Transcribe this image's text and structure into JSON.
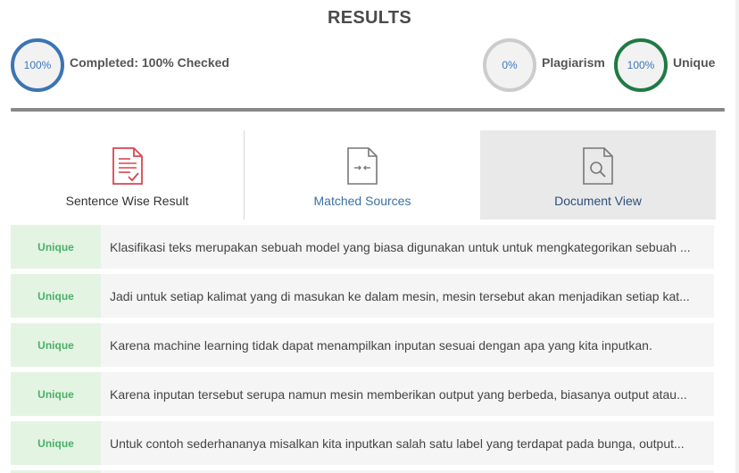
{
  "header": {
    "title": "RESULTS"
  },
  "stats": {
    "completed": {
      "value": "100%",
      "label": "Completed: 100% Checked",
      "color": "#3b74b3"
    },
    "plagiarism": {
      "value": "0%",
      "label": "Plagiarism",
      "color": "#cccccc"
    },
    "unique": {
      "value": "100%",
      "label": "Unique",
      "color": "#1f7a45"
    }
  },
  "tabs": [
    {
      "label": "Sentence Wise Result",
      "icon": "document-check-icon",
      "color": "#d9454f"
    },
    {
      "label": "Matched Sources",
      "icon": "document-compare-icon",
      "color": "#777777"
    },
    {
      "label": "Document View",
      "icon": "document-search-icon",
      "color": "#777777",
      "active": true
    }
  ],
  "results": [
    {
      "status": "Unique",
      "text": "Klasifikasi teks merupakan sebuah model yang biasa digunakan untuk untuk mengkategorikan sebuah ..."
    },
    {
      "status": "Unique",
      "text": "Jadi untuk setiap kalimat yang di masukan ke dalam mesin, mesin tersebut akan menjadikan setiap kat..."
    },
    {
      "status": "Unique",
      "text": "Karena machine learning tidak dapat menampilkan inputan sesuai dengan apa yang kita inputkan."
    },
    {
      "status": "Unique",
      "text": "Karena inputan tersebut serupa namun mesin memberikan output yang berbeda, biasanya output atau..."
    },
    {
      "status": "Unique",
      "text": "Untuk contoh sederhananya misalkan kita inputkan salah satu label yang terdapat pada bunga, output..."
    }
  ],
  "colors": {
    "unique_badge_bg": "#e3f4e3",
    "unique_badge_text": "#4caf67",
    "divider": "#888888"
  }
}
